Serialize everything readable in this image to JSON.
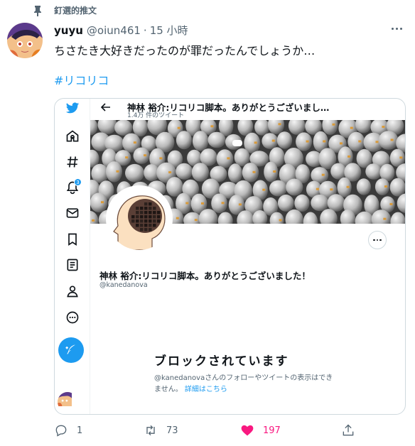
{
  "pinned_label": "釘選的推文",
  "tweet": {
    "author_name": "yuyu",
    "author_handle": "@oiun461",
    "separator": "·",
    "time": "15 小時",
    "text": "ちさたき大好きだったのが罪だったんでしょうか…",
    "hashtag": "#リコリコ"
  },
  "card": {
    "profile_title": "神林 裕介:リコリコ脚本。ありがとうございまし…",
    "tweet_count": "1.4万 件のツイート",
    "display_name": "神林 裕介:リコリコ脚本。ありがとうございました！",
    "handle": "@kanedanova",
    "notifications_badge": "3",
    "blocked_title": "ブロックされています",
    "blocked_desc": "@kanedanovaさんのフォローやツイートの表示はできません。",
    "blocked_link": "詳細はこちら"
  },
  "actions": {
    "reply_count": "1",
    "retweet_count": "73",
    "like_count": "197"
  },
  "colors": {
    "accent": "#1d9bf0",
    "like": "#f91880",
    "muted": "#536471"
  }
}
